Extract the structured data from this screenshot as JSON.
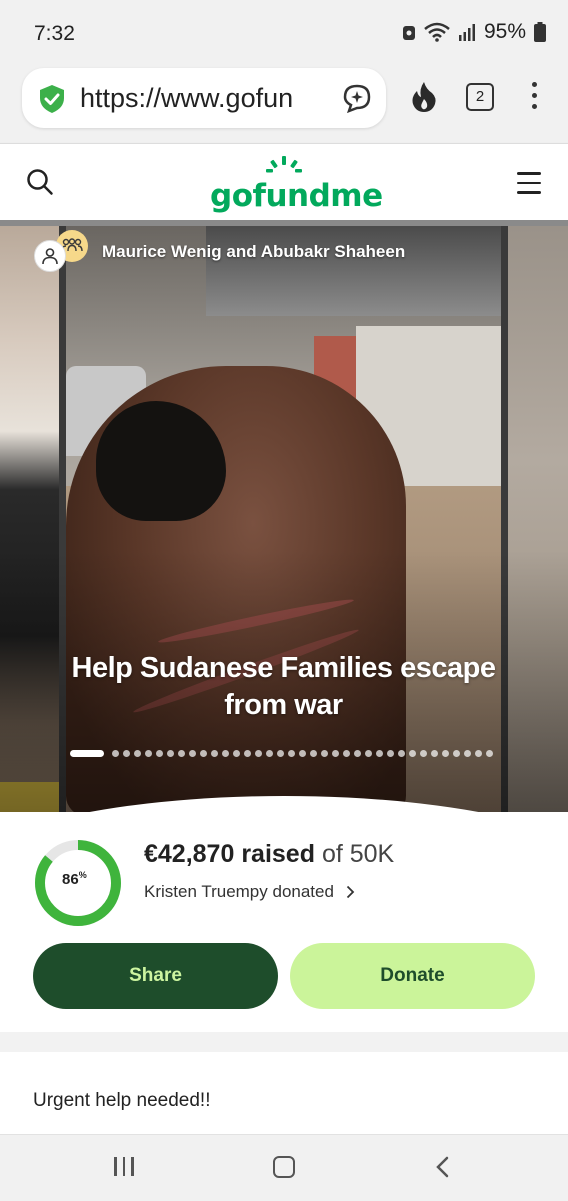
{
  "status_bar": {
    "time": "7:32",
    "battery": "95%",
    "icons": [
      "alarm-icon",
      "wifi-icon",
      "signal-icon",
      "battery-icon"
    ]
  },
  "browser": {
    "url": "https://www.gofun",
    "tab_count": "2",
    "icons": [
      "shield-check-icon",
      "assistant-icon",
      "fire-icon",
      "tabs-icon",
      "more-vert-icon"
    ],
    "accent_color": "#3cb04a"
  },
  "site_header": {
    "logo": "gofundme",
    "logo_color": "#02a95c",
    "icons": [
      "search-icon",
      "hamburger-menu-icon"
    ]
  },
  "campaign": {
    "organizers": "Maurice Wenig and Abubakr Shaheen",
    "title": "Help Sudanese Families escape from war",
    "carousel": {
      "active_index": 0,
      "total_dots": 36
    }
  },
  "progress": {
    "percent": 0.86,
    "percent_label": "86",
    "percent_sign": "%",
    "raised_amount": "€42,870 raised",
    "goal_text": "of 50K",
    "recent_donor": "Kristen Truempy donated",
    "ring_color": "#3fb43c",
    "ring_track_color": "#e6e6e6"
  },
  "actions": {
    "share_label": "Share",
    "donate_label": "Donate",
    "share_color": "#1e4d2b",
    "donate_color": "#cbf49a"
  },
  "story": {
    "text": "Urgent help needed!!"
  },
  "nav_bar": {
    "icons": [
      "recent-apps-icon",
      "home-icon",
      "back-icon"
    ]
  }
}
